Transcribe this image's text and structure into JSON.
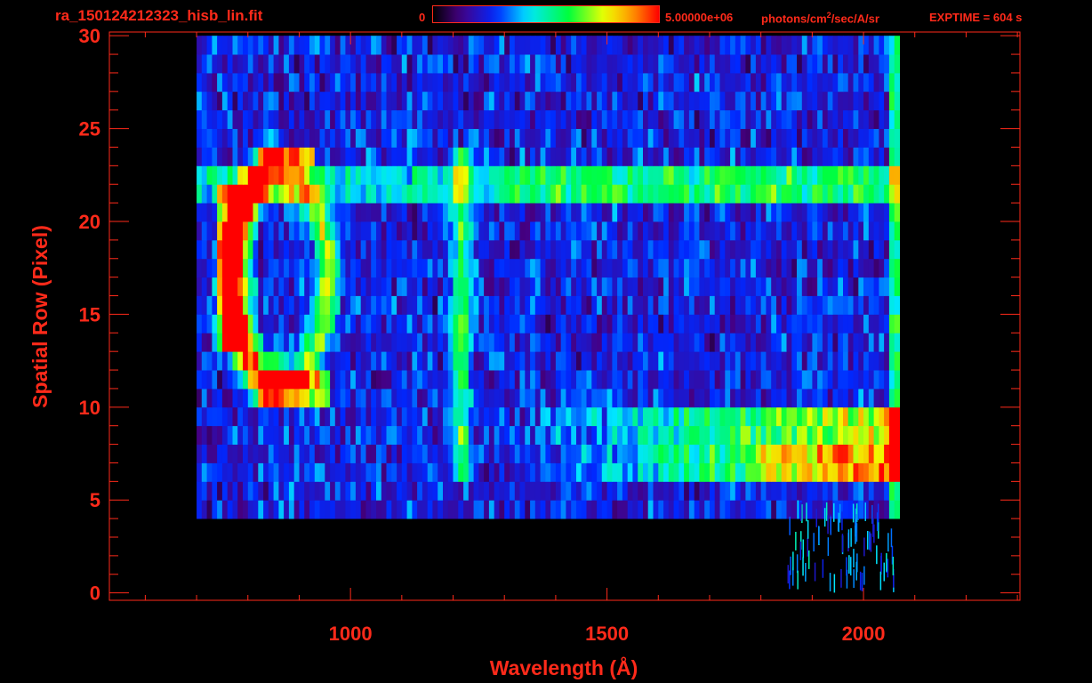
{
  "header": {
    "file_title": "ra_150124212323_hisb_lin.fit",
    "colorbar_min": "0",
    "colorbar_max": "5.00000e+06",
    "colorbar_units": "photons/cm",
    "colorbar_units_sup": "2",
    "colorbar_units_tail": "/sec/A/sr",
    "exptime": "EXPTIME = 604 s"
  },
  "colors": {
    "text": "#ff2a1a",
    "background": "#000000"
  },
  "chart_data": {
    "type": "heatmap",
    "title": "",
    "xlabel": "Wavelength (Å)",
    "ylabel": "Spatial Row (Pixel)",
    "xlim": [
      530,
      2305
    ],
    "ylim": [
      -0.4,
      30.2
    ],
    "x_ticks": [
      1000,
      1500,
      2000
    ],
    "y_ticks": [
      0,
      5,
      10,
      15,
      20,
      25,
      30
    ],
    "colorbar_range": [
      0,
      5000000
    ],
    "colormap": "rainbow",
    "features": {
      "data_extent_x": [
        700,
        2070
      ],
      "data_extent_y": [
        4,
        30
      ],
      "ring_center": [
        860,
        17
      ],
      "emission_line_x": 1216,
      "bright_bands_y": [
        [
          6,
          10
        ],
        [
          21,
          23
        ]
      ]
    }
  }
}
